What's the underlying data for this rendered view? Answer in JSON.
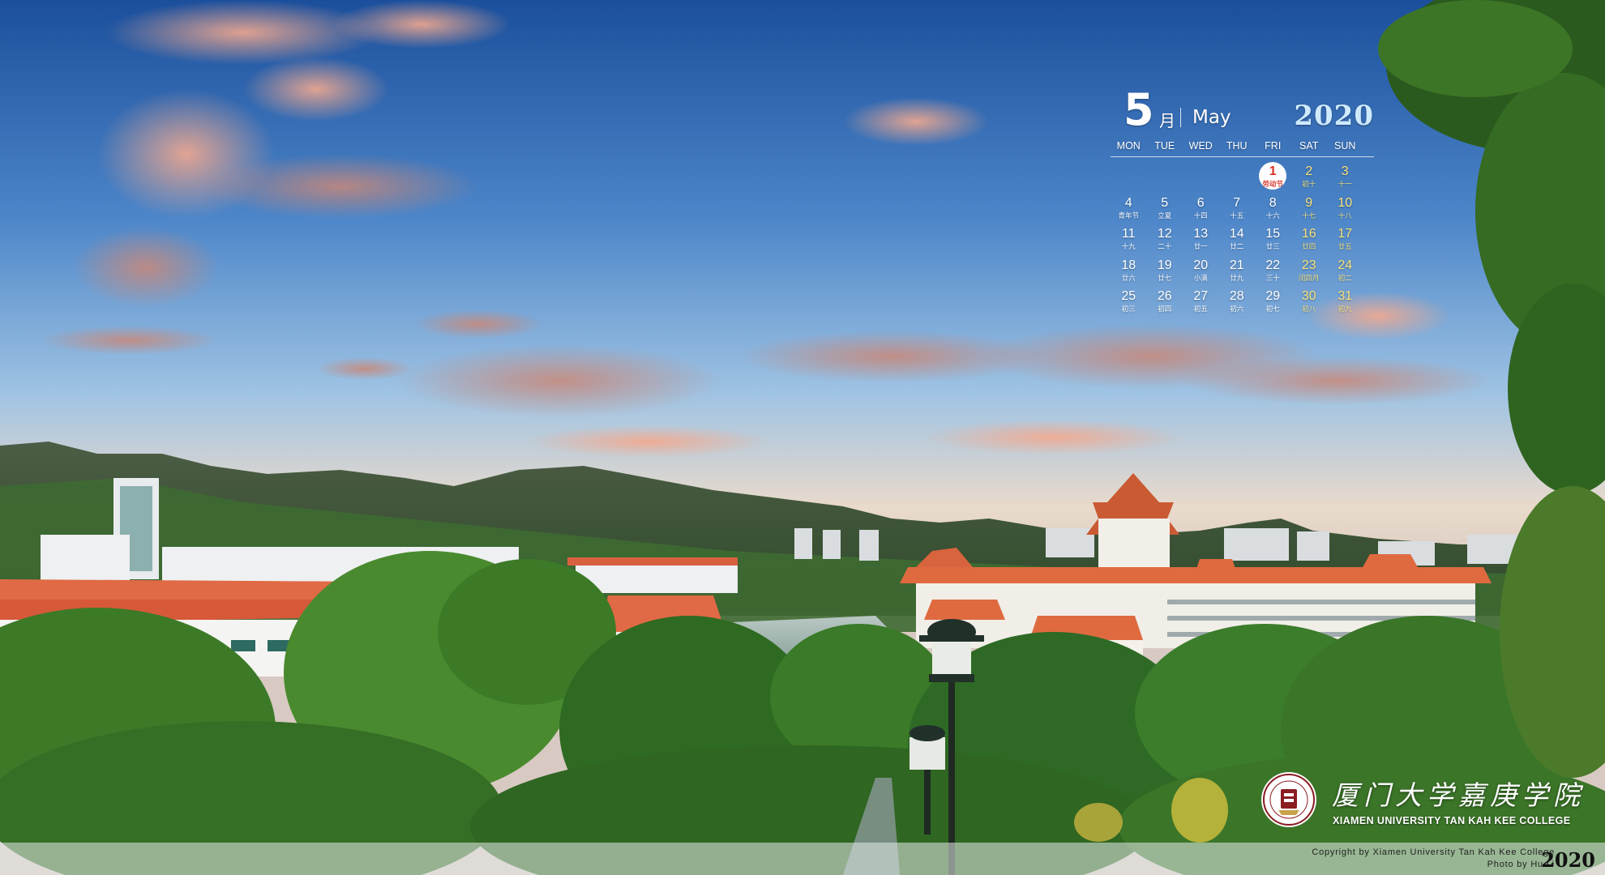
{
  "calendar": {
    "month_num": "5",
    "month_cn": "月",
    "month_en": "May",
    "year": "2020",
    "weekdays": [
      "MON",
      "TUE",
      "WED",
      "THU",
      "FRI",
      "SAT",
      "SUN"
    ],
    "days": [
      {
        "n": "",
        "s": ""
      },
      {
        "n": "",
        "s": ""
      },
      {
        "n": "",
        "s": ""
      },
      {
        "n": "",
        "s": ""
      },
      {
        "n": "1",
        "s": "劳动节",
        "holiday": true
      },
      {
        "n": "2",
        "s": "初十",
        "weekend": true
      },
      {
        "n": "3",
        "s": "十一",
        "weekend": true
      },
      {
        "n": "4",
        "s": "青年节"
      },
      {
        "n": "5",
        "s": "立夏"
      },
      {
        "n": "6",
        "s": "十四"
      },
      {
        "n": "7",
        "s": "十五"
      },
      {
        "n": "8",
        "s": "十六"
      },
      {
        "n": "9",
        "s": "十七",
        "weekend": true
      },
      {
        "n": "10",
        "s": "十八",
        "weekend": true
      },
      {
        "n": "11",
        "s": "十九"
      },
      {
        "n": "12",
        "s": "二十"
      },
      {
        "n": "13",
        "s": "廿一"
      },
      {
        "n": "14",
        "s": "廿二"
      },
      {
        "n": "15",
        "s": "廿三"
      },
      {
        "n": "16",
        "s": "廿四",
        "weekend": true
      },
      {
        "n": "17",
        "s": "廿五",
        "weekend": true
      },
      {
        "n": "18",
        "s": "廿六"
      },
      {
        "n": "19",
        "s": "廿七"
      },
      {
        "n": "20",
        "s": "小满"
      },
      {
        "n": "21",
        "s": "廿九"
      },
      {
        "n": "22",
        "s": "三十"
      },
      {
        "n": "23",
        "s": "闰四月",
        "weekend": true
      },
      {
        "n": "24",
        "s": "初二",
        "weekend": true
      },
      {
        "n": "25",
        "s": "初三"
      },
      {
        "n": "26",
        "s": "初四"
      },
      {
        "n": "27",
        "s": "初五"
      },
      {
        "n": "28",
        "s": "初六"
      },
      {
        "n": "29",
        "s": "初七"
      },
      {
        "n": "30",
        "s": "初八",
        "weekend": true
      },
      {
        "n": "31",
        "s": "初九",
        "weekend": true
      }
    ]
  },
  "brand": {
    "name_cn": "厦门大学嘉庚学院",
    "name_en": "XIAMEN UNIVERSITY TAN KAH KEE COLLEGE"
  },
  "footer": {
    "copyright": "Copyright by Xiamen University Tan Kah Kee College",
    "photo": "Photo by Hu Li",
    "year": "2020"
  },
  "colors": {
    "sky_top": "#1d5aa6",
    "sky_mid": "#6fa2d6",
    "horizon": "#e9d6c2",
    "roof": "#e0663e",
    "foliage": "#3f7d2a",
    "weekend": "#f6e27a",
    "holiday": "#d93025"
  }
}
